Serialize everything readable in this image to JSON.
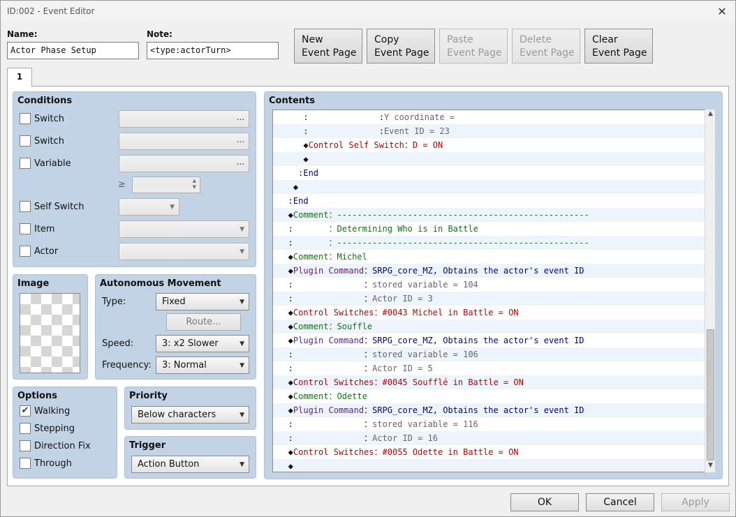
{
  "window": {
    "title": "ID:002 - Event Editor",
    "close_glyph": "✕"
  },
  "name_label": "Name:",
  "name_value": "Actor Phase Setup",
  "note_label": "Note:",
  "note_value": "<type:actorTurn>",
  "top_buttons": [
    {
      "label": "New\nEvent Page",
      "enabled": true
    },
    {
      "label": "Copy\nEvent Page",
      "enabled": true
    },
    {
      "label": "Paste\nEvent Page",
      "enabled": false
    },
    {
      "label": "Delete\nEvent Page",
      "enabled": false
    },
    {
      "label": "Clear\nEvent Page",
      "enabled": true
    }
  ],
  "tab_label": "1",
  "conditions": {
    "title": "Conditions",
    "switch1": "Switch",
    "switch2": "Switch",
    "variable": "Variable",
    "ellipsis": "...",
    "gte": "≥",
    "self_switch": "Self Switch",
    "item": "Item",
    "actor": "Actor"
  },
  "image": {
    "title": "Image"
  },
  "movement": {
    "title": "Autonomous Movement",
    "type_label": "Type:",
    "type_value": "Fixed",
    "route_label": "Route...",
    "speed_label": "Speed:",
    "speed_value": "3: x2 Slower",
    "frequency_label": "Frequency:",
    "frequency_value": "3: Normal"
  },
  "options": {
    "title": "Options",
    "walking": "Walking",
    "stepping": "Stepping",
    "direction_fix": "Direction Fix",
    "through": "Through",
    "walking_checked": true
  },
  "priority": {
    "title": "Priority",
    "value": "Below characters"
  },
  "trigger": {
    "title": "Trigger",
    "value": "Action Button"
  },
  "contents": {
    "title": "Contents",
    "lines": [
      {
        "parts": [
          {
            "t": "      :              ",
            "c": "#111"
          },
          {
            "t": ":",
            "c": "#111"
          },
          {
            "t": "Y coordinate =",
            "c": "#666"
          }
        ]
      },
      {
        "parts": [
          {
            "t": "      :              ",
            "c": "#111"
          },
          {
            "t": ":",
            "c": "#111"
          },
          {
            "t": "Event ID = 23",
            "c": "#666"
          }
        ]
      },
      {
        "parts": [
          {
            "t": "      ◆",
            "c": "#111"
          },
          {
            "t": "Control Self Switch",
            "c": "#c00000"
          },
          {
            "t": "：",
            "c": "#c00000"
          },
          {
            "t": "D = ON",
            "c": "#c00000"
          }
        ]
      },
      {
        "parts": [
          {
            "t": "      ◆",
            "c": "#111"
          }
        ]
      },
      {
        "parts": [
          {
            "t": "     :",
            "c": "#111"
          },
          {
            "t": "End",
            "c": "#00008b"
          }
        ]
      },
      {
        "parts": [
          {
            "t": "    ◆",
            "c": "#111"
          }
        ]
      },
      {
        "parts": [
          {
            "t": "   :",
            "c": "#111"
          },
          {
            "t": "End",
            "c": "#00008b"
          }
        ]
      },
      {
        "parts": [
          {
            "t": "   ◆",
            "c": "#111"
          },
          {
            "t": "Comment",
            "c": "#0a7a0a"
          },
          {
            "t": "：",
            "c": "#0a7a0a"
          },
          {
            "t": "--------------------------------------------------",
            "c": "#0a7a0a"
          }
        ]
      },
      {
        "parts": [
          {
            "t": "   :       ",
            "c": "#111"
          },
          {
            "t": "：",
            "c": "#0a7a0a"
          },
          {
            "t": "Determining Who is in Battle",
            "c": "#0a7a0a"
          }
        ]
      },
      {
        "parts": [
          {
            "t": "   :       ",
            "c": "#111"
          },
          {
            "t": "：",
            "c": "#0a7a0a"
          },
          {
            "t": "--------------------------------------------------",
            "c": "#0a7a0a"
          }
        ]
      },
      {
        "parts": [
          {
            "t": "   ◆",
            "c": "#111"
          },
          {
            "t": "Comment",
            "c": "#0a7a0a"
          },
          {
            "t": "：",
            "c": "#0a7a0a"
          },
          {
            "t": "Michel",
            "c": "#0a7a0a"
          }
        ]
      },
      {
        "parts": [
          {
            "t": "   ◆",
            "c": "#111"
          },
          {
            "t": "Plugin Command",
            "c": "#6a1a9a"
          },
          {
            "t": "：",
            "c": "#111"
          },
          {
            "t": "SRPG_core_MZ, Obtains the actor's event ID",
            "c": "#00008b"
          }
        ]
      },
      {
        "parts": [
          {
            "t": "   :              ",
            "c": "#111"
          },
          {
            "t": "：",
            "c": "#111"
          },
          {
            "t": "stored variable = 104",
            "c": "#666"
          }
        ]
      },
      {
        "parts": [
          {
            "t": "   :              ",
            "c": "#111"
          },
          {
            "t": "：",
            "c": "#111"
          },
          {
            "t": "Actor ID = 3",
            "c": "#666"
          }
        ]
      },
      {
        "parts": [
          {
            "t": "   ◆",
            "c": "#111"
          },
          {
            "t": "Control Switches",
            "c": "#c00000"
          },
          {
            "t": "：",
            "c": "#c00000"
          },
          {
            "t": "#0043 Michel in Battle = ON",
            "c": "#c00000"
          }
        ]
      },
      {
        "parts": [
          {
            "t": "   ◆",
            "c": "#111"
          },
          {
            "t": "Comment",
            "c": "#0a7a0a"
          },
          {
            "t": "：",
            "c": "#0a7a0a"
          },
          {
            "t": "Souffle",
            "c": "#0a7a0a"
          }
        ]
      },
      {
        "parts": [
          {
            "t": "   ◆",
            "c": "#111"
          },
          {
            "t": "Plugin Command",
            "c": "#6a1a9a"
          },
          {
            "t": "：",
            "c": "#111"
          },
          {
            "t": "SRPG_core_MZ, Obtains the actor's event ID",
            "c": "#00008b"
          }
        ]
      },
      {
        "parts": [
          {
            "t": "   :              ",
            "c": "#111"
          },
          {
            "t": "：",
            "c": "#111"
          },
          {
            "t": "stored variable = 106",
            "c": "#666"
          }
        ]
      },
      {
        "parts": [
          {
            "t": "   :              ",
            "c": "#111"
          },
          {
            "t": "：",
            "c": "#111"
          },
          {
            "t": "Actor ID = 5",
            "c": "#666"
          }
        ]
      },
      {
        "parts": [
          {
            "t": "   ◆",
            "c": "#111"
          },
          {
            "t": "Control Switches",
            "c": "#c00000"
          },
          {
            "t": "：",
            "c": "#c00000"
          },
          {
            "t": "#0045 Soufflé in Battle = ON",
            "c": "#c00000"
          }
        ]
      },
      {
        "parts": [
          {
            "t": "   ◆",
            "c": "#111"
          },
          {
            "t": "Comment",
            "c": "#0a7a0a"
          },
          {
            "t": "：",
            "c": "#0a7a0a"
          },
          {
            "t": "Odette",
            "c": "#0a7a0a"
          }
        ]
      },
      {
        "parts": [
          {
            "t": "   ◆",
            "c": "#111"
          },
          {
            "t": "Plugin Command",
            "c": "#6a1a9a"
          },
          {
            "t": "：",
            "c": "#111"
          },
          {
            "t": "SRPG_core_MZ, Obtains the actor's event ID",
            "c": "#00008b"
          }
        ]
      },
      {
        "parts": [
          {
            "t": "   :              ",
            "c": "#111"
          },
          {
            "t": "：",
            "c": "#111"
          },
          {
            "t": "stored variable = 116",
            "c": "#666"
          }
        ]
      },
      {
        "parts": [
          {
            "t": "   :              ",
            "c": "#111"
          },
          {
            "t": "：",
            "c": "#111"
          },
          {
            "t": "Actor ID = 16",
            "c": "#666"
          }
        ]
      },
      {
        "parts": [
          {
            "t": "   ◆",
            "c": "#111"
          },
          {
            "t": "Control Switches",
            "c": "#c00000"
          },
          {
            "t": "：",
            "c": "#c00000"
          },
          {
            "t": "#0055 Odette in Battle = ON",
            "c": "#c00000"
          }
        ]
      },
      {
        "parts": [
          {
            "t": "   ◆",
            "c": "#111"
          }
        ]
      }
    ]
  },
  "scroll_glyphs": {
    "up": "▲",
    "down": "▼"
  },
  "footer": {
    "ok": "OK",
    "cancel": "Cancel",
    "apply": "Apply"
  }
}
